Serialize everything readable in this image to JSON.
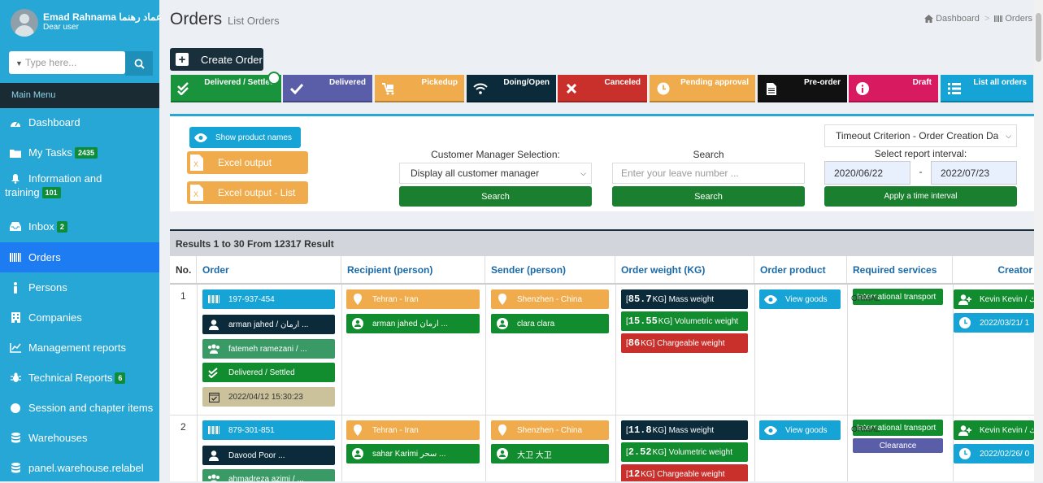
{
  "user": {
    "name": "Emad Rahnama عماد رهنما",
    "role": "Dear user"
  },
  "sidebar_search": {
    "placeholder": "Type here..."
  },
  "main_menu_label": "Main Menu",
  "menu": [
    {
      "label": "Dashboard",
      "icon": "dashboard-icon"
    },
    {
      "label": "My Tasks",
      "icon": "folder-icon",
      "badge": "2435"
    },
    {
      "label": "Information and",
      "label2": "training",
      "icon": "bell-icon",
      "badge": "101"
    },
    {
      "label": "Inbox",
      "icon": "inbox-icon",
      "badge": "2"
    },
    {
      "label": "Orders",
      "icon": "barcode-icon",
      "active": true
    },
    {
      "label": "Persons",
      "icon": "person-icon"
    },
    {
      "label": "Companies",
      "icon": "building-icon"
    },
    {
      "label": "Management reports",
      "icon": "chart-icon"
    },
    {
      "label": "Technical Reports",
      "icon": "bug-icon",
      "badge": "6"
    },
    {
      "label": "Session and chapter items",
      "icon": "circle-icon"
    },
    {
      "label": "Warehouses",
      "icon": "database-icon"
    },
    {
      "label": "panel.warehouse.relabel",
      "icon": "database-icon"
    }
  ],
  "page": {
    "title": "Orders",
    "subtitle": "List Orders"
  },
  "breadcrumb": {
    "home": "Dashboard",
    "current": "Orders"
  },
  "create_button": "Create Order",
  "status_tabs": [
    {
      "label": "Delivered / Settled",
      "color": "#19933c"
    },
    {
      "label": "Delivered",
      "color": "#5a5ea8"
    },
    {
      "label": "Pickedup",
      "color": "#f0ac4c"
    },
    {
      "label": "Doing/Open",
      "color": "#0b2a3a"
    },
    {
      "label": "Canceled",
      "color": "#c9302c"
    },
    {
      "label": "Pending approval",
      "color": "#f0ac4c"
    },
    {
      "label": "Pre-order",
      "color": "#111111"
    },
    {
      "label": "Draft",
      "color": "#d81b60"
    },
    {
      "label": "List all orders",
      "color": "#16a3d6"
    }
  ],
  "filters": {
    "show_product_names": "Show product names",
    "excel_output": "Excel output",
    "excel_output_list": "Excel output - List",
    "customer_manager_label": "Customer Manager Selection:",
    "customer_manager_value": "Display all customer manager",
    "search_label": "Search",
    "search_placeholder": "Enter your leave number ...",
    "search_button": "Search",
    "timeout_select": "Timeout Criterion - Order Creation Da",
    "interval_label": "Select report interval:",
    "date_from": "2020/06/22",
    "date_sep": "-",
    "date_to": "2022/07/23",
    "apply_button": "Apply a time interval"
  },
  "results": {
    "summary": "Results 1 to 30 From 12317 Result",
    "columns": [
      "No.",
      "Order",
      "Recipient (person)",
      "Sender (person)",
      "Order weight (KG)",
      "Order product",
      "Required services",
      "Creator"
    ],
    "rows": [
      {
        "no": "1",
        "order_code": "197-937-454",
        "customer": "arman jahed / ارمان ...",
        "group": "fatemeh ramezani / ...",
        "status": "Delivered / Settled",
        "date": "2022/04/12 15:30:23",
        "recipient_location": "Tehran - Iran",
        "recipient_name": "arman jahed ارمان ...",
        "sender_location": "Shenzhen - China",
        "sender_name": "clara clara",
        "mass_weight_value": "85.7",
        "mass_weight_label": "KG] Mass weight",
        "vol_weight_value": "15.55",
        "vol_weight_label": "KG] Volumetric weight",
        "charge_weight_value": "86",
        "charge_weight_label": "KG] Chargeable weight",
        "product": "View goods",
        "service": "International transport",
        "service_under": "ORMAL",
        "creator": "Kevin Kevin / ك",
        "creator_date": "2022/03/21/ 1"
      },
      {
        "no": "2",
        "order_code": "879-301-851",
        "customer": "Davood Poor ...",
        "group": "ahmadreza azimi / ...",
        "recipient_location": "Tehran - Iran",
        "recipient_name": "sahar Karimi سحر ...",
        "sender_location": "Shenzhen - China",
        "sender_name": "大卫 大卫",
        "mass_weight_value": "11.8",
        "mass_weight_label": "KG] Mass weight",
        "vol_weight_value": "2.52",
        "vol_weight_label": "KG] Volumetric weight",
        "charge_weight_value": "12",
        "charge_weight_label": "KG] Chargeable weight",
        "product": "View goods",
        "service": "International transport",
        "service_under": "ORMAL",
        "service2": "Clearance",
        "creator": "Kevin Kevin / ك",
        "creator_date": "2022/02/26/ 0"
      }
    ]
  }
}
